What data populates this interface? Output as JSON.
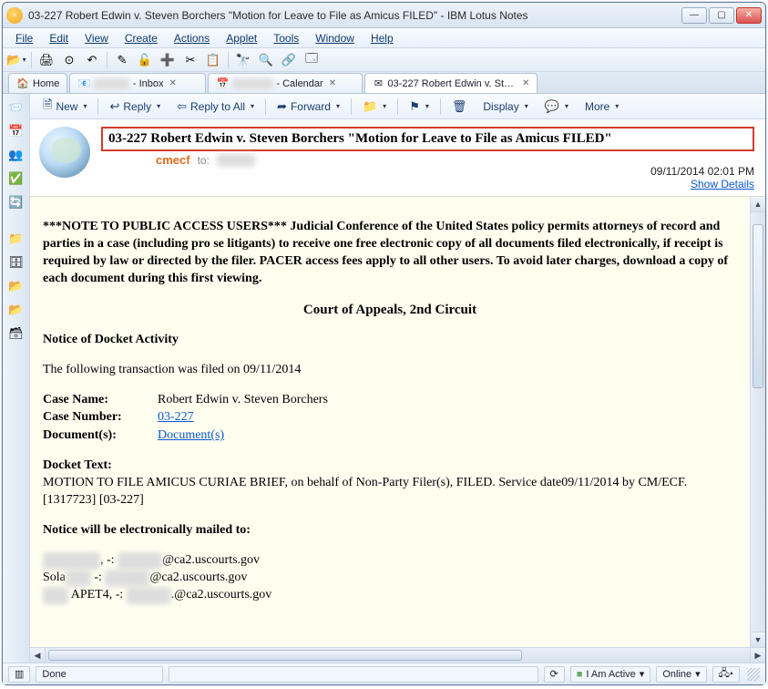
{
  "titlebar": {
    "title": "03-227 Robert Edwin v. Steven Borchers \"Motion for Leave to File as Amicus FILED\" - IBM Lotus Notes"
  },
  "menubar": [
    "File",
    "Edit",
    "View",
    "Create",
    "Actions",
    "Applet",
    "Tools",
    "Window",
    "Help"
  ],
  "tabs": [
    {
      "label": "Home",
      "icon": "🏠"
    },
    {
      "label": "- Inbox",
      "icon": "📧",
      "closable": true,
      "blurPrefix": true
    },
    {
      "label": "- Calendar",
      "icon": "📅",
      "closable": true,
      "blurPrefix": true
    },
    {
      "label": "03-227 Robert Edwin v. Steven ...",
      "icon": "✉",
      "closable": true,
      "active": true
    }
  ],
  "actions": {
    "new": "New",
    "reply": "Reply",
    "replyAll": "Reply to All",
    "forward": "Forward",
    "display": "Display",
    "more": "More"
  },
  "header": {
    "subject": "03-227 Robert Edwin v. Steven Borchers \"Motion for Leave to File as Amicus FILED\"",
    "from": "cmecf",
    "toLabel": "to:",
    "datetime": "09/11/2014 02:01 PM",
    "showDetails": "Show Details"
  },
  "body": {
    "note": "***NOTE TO PUBLIC ACCESS USERS*** Judicial Conference of the United States policy permits attorneys of record and parties in a case (including pro se litigants) to receive one free electronic copy of all documents filed electronically, if receipt is required by law or directed by the filer. PACER access fees apply to all other users. To avoid later charges, download a copy of each document during this first viewing.",
    "court": "Court of Appeals, 2nd Circuit",
    "noticeTitle": "Notice of Docket Activity",
    "txnLine": "The following transaction was filed on 09/11/2014",
    "caseNameLabel": "Case Name:",
    "caseName": "Robert Edwin v. Steven Borchers",
    "caseNumberLabel": "Case Number:",
    "caseNumber": "03-227",
    "documentsLabel": "Document(s):",
    "documentsLink": "Document(s)",
    "docketTextLabel": "Docket Text:",
    "docketText": "MOTION TO FILE AMICUS CURIAE BRIEF, on behalf of Non-Party Filer(s), FILED. Service date09/11/2014 by CM/ECF.[1317723] [03-227]",
    "mailedLabel": "Notice will be electronically mailed to:",
    "recipients": [
      {
        "prefix": "",
        "name": "████████",
        "suffix": ", -: ",
        "email": "████████@ca2.uscourts.gov"
      },
      {
        "prefix": "Sola",
        "name": "████",
        "suffix": " -: ",
        "email": "████████@ca2.uscourts.gov"
      },
      {
        "prefix": "",
        "name": "████ APET4",
        "suffix": ", -: ",
        "email": "████████.@ca2.uscourts.gov"
      }
    ]
  },
  "statusbar": {
    "left": "Done",
    "active": "I Am Active",
    "online": "Online"
  }
}
